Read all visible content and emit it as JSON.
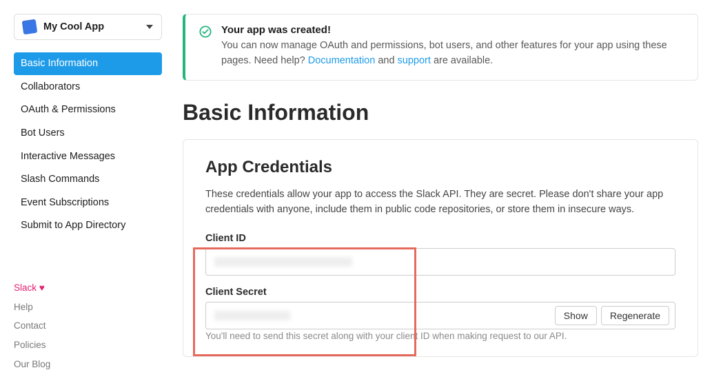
{
  "app_selector": {
    "name": "My Cool App"
  },
  "nav": {
    "items": [
      "Basic Information",
      "Collaborators",
      "OAuth & Permissions",
      "Bot Users",
      "Interactive Messages",
      "Slash Commands",
      "Event Subscriptions",
      "Submit to App Directory"
    ],
    "active_index": 0
  },
  "footer": {
    "items": [
      "Slack ♥",
      "Help",
      "Contact",
      "Policies",
      "Our Blog"
    ]
  },
  "banner": {
    "title": "Your app was created!",
    "text_before": "You can now manage OAuth and permissions, bot users, and other features for your app using these pages. Need help? ",
    "doc_link": "Documentation",
    "mid_text": " and ",
    "support_link": "support",
    "text_after": " are available."
  },
  "page": {
    "title": "Basic Information"
  },
  "credentials": {
    "heading": "App Credentials",
    "description": "These credentials allow your app to access the Slack API. They are secret. Please don't share your app credentials with anyone, include them in public code repositories, or store them in insecure ways.",
    "client_id_label": "Client ID",
    "client_secret_label": "Client Secret",
    "show_label": "Show",
    "regenerate_label": "Regenerate",
    "hint": "You'll need to send this secret along with your client ID when making request to our API."
  }
}
